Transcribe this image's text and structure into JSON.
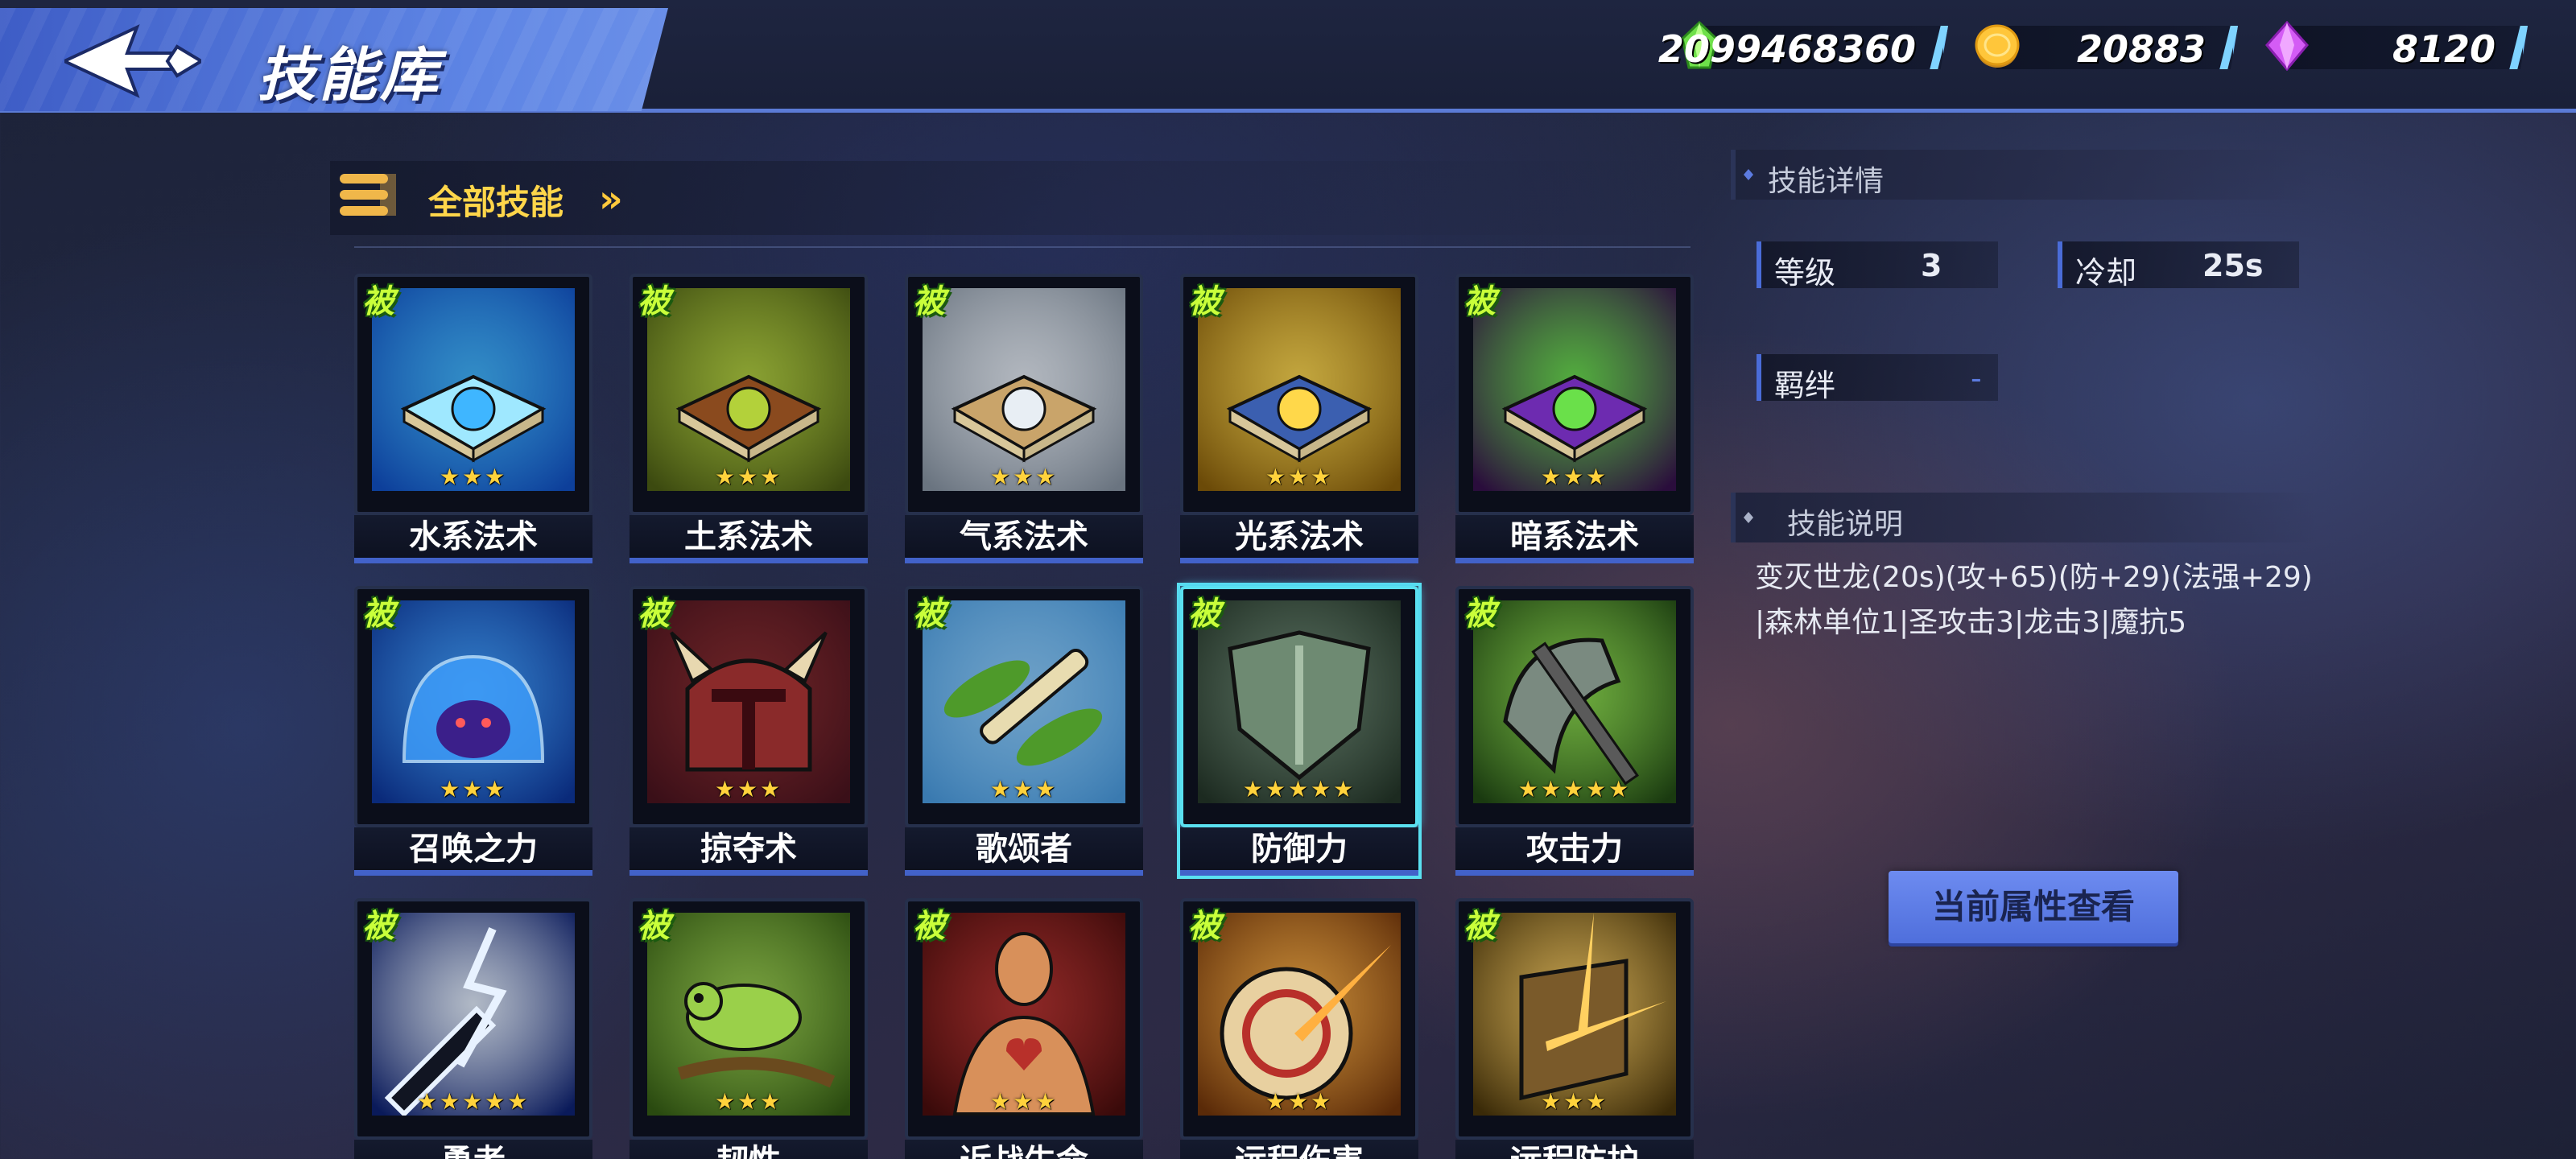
{
  "header": {
    "title": "技能库",
    "currencies": [
      {
        "icon": "emerald-gem-icon",
        "value": "2099468360"
      },
      {
        "icon": "gold-coin-icon",
        "value": "20883"
      },
      {
        "icon": "purple-diamond-icon",
        "value": "8120"
      }
    ]
  },
  "filter": {
    "label": "全部技能"
  },
  "skills": [
    {
      "name": "水系法术",
      "badge": "被",
      "stars": "★★★",
      "icon": "water-spellbook-icon"
    },
    {
      "name": "土系法术",
      "badge": "被",
      "stars": "★★★",
      "icon": "earth-spellbook-icon"
    },
    {
      "name": "气系法术",
      "badge": "被",
      "stars": "★★★",
      "icon": "air-spellbook-icon"
    },
    {
      "name": "光系法术",
      "badge": "被",
      "stars": "★★★",
      "icon": "light-spellbook-icon"
    },
    {
      "name": "暗系法术",
      "badge": "被",
      "stars": "★★★",
      "icon": "dark-spellbook-icon"
    },
    {
      "name": "召唤之力",
      "badge": "被",
      "stars": "★★★",
      "icon": "summon-ghost-icon"
    },
    {
      "name": "掠夺术",
      "badge": "被",
      "stars": "★★★",
      "icon": "horned-helmet-icon"
    },
    {
      "name": "歌颂者",
      "badge": "被",
      "stars": "★★★",
      "icon": "flute-leaves-icon"
    },
    {
      "name": "防御力",
      "badge": "被",
      "stars": "★★★★★",
      "icon": "shield-icon"
    },
    {
      "name": "攻击力",
      "badge": "被",
      "stars": "★★★★★",
      "icon": "axe-icon"
    },
    {
      "name": "勇者",
      "badge": "被",
      "stars": "★★★★★",
      "icon": "lightning-sword-icon"
    },
    {
      "name": "韧性",
      "badge": "被",
      "stars": "★★★",
      "icon": "chameleon-icon"
    },
    {
      "name": "近战生命",
      "badge": "被",
      "stars": "★★★",
      "icon": "heart-body-icon"
    },
    {
      "name": "远程伤害",
      "badge": "被",
      "stars": "★★★",
      "icon": "target-arrow-icon"
    },
    {
      "name": "远程防护",
      "badge": "被",
      "stars": "★★★",
      "icon": "arrow-shield-icon"
    }
  ],
  "details": {
    "section_title": "技能详情",
    "level_label": "等级",
    "level_value": "3",
    "cooldown_label": "冷却",
    "cooldown_value": "25s",
    "bond_label": "羁绊",
    "bond_value": "-",
    "desc_title": "技能说明",
    "desc_line1": "变灭世龙(20s)(攻+65)(防+29)(法强+29)",
    "desc_line2": "|森林单位1|圣攻击3|龙击3|魔抗5",
    "view_button": "当前属性查看"
  },
  "colors": {
    "accent": "#5b7bd6",
    "gold_text": "#ffd64a",
    "badge_green": "#c9ff3a",
    "selected_outline": "#5ae0f0"
  }
}
